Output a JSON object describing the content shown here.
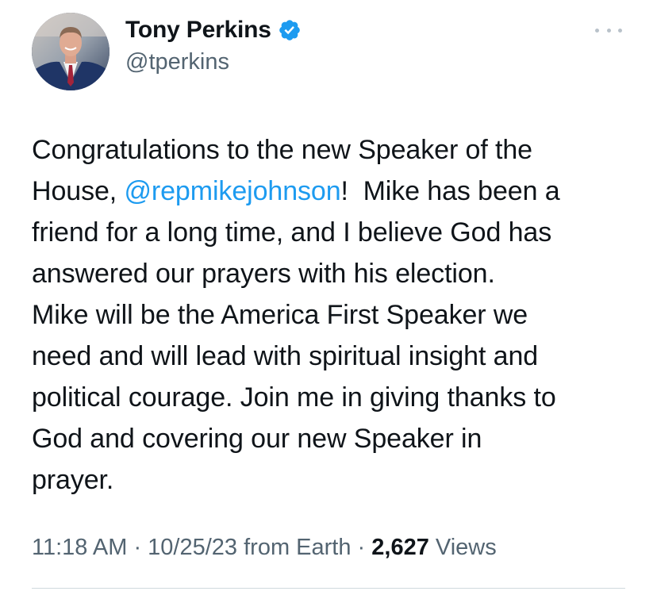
{
  "author": {
    "display_name": "Tony Perkins",
    "handle": "@tperkins",
    "verified": true,
    "avatar_icon": "profile-photo"
  },
  "more_icon": "more-horizontal-icon",
  "tweet": {
    "line1": "Congratulations to the new Speaker of the",
    "line2_prefix": "House, ",
    "mention": "@repmikejohnson",
    "line2_suffix": "!  Mike has been a",
    "line3": "friend for a long time, and I believe God has",
    "line4": "answered our prayers with his election.",
    "line5": "Mike will be the America First Speaker we",
    "line6": "need and will lead with spiritual insight and",
    "line7": "political courage. Join me in giving thanks to",
    "line8": "God and covering our new Speaker in",
    "line9": "prayer."
  },
  "meta": {
    "time": "11:18 AM",
    "separator": " · ",
    "date": "10/25/23",
    "source": " from Earth",
    "views_count": "2,627",
    "views_label": " Views"
  },
  "colors": {
    "text": "#0f1419",
    "secondary": "#536471",
    "accent": "#1d9bf0"
  }
}
